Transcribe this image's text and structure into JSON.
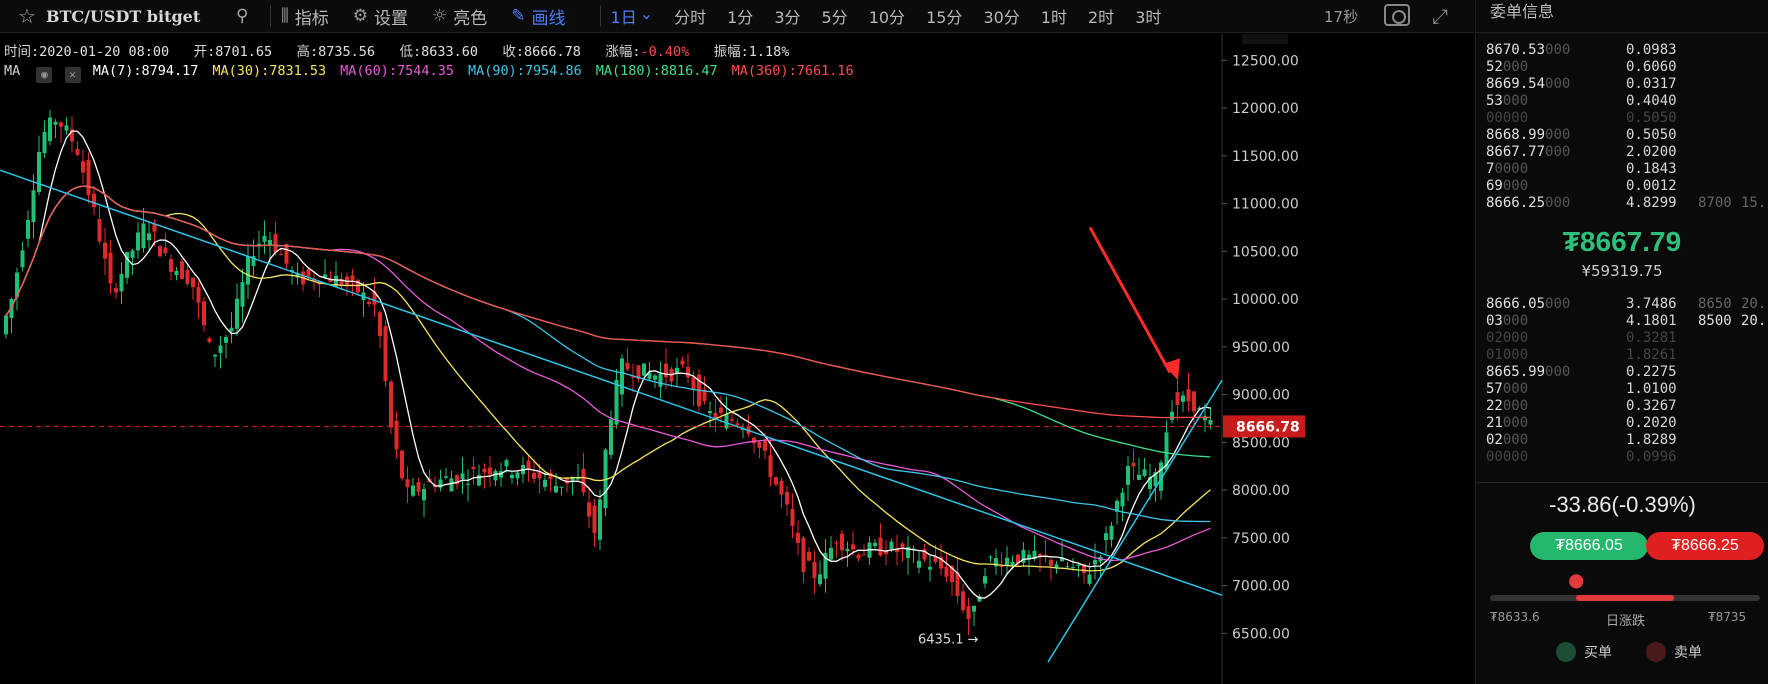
{
  "toolbar": {
    "pair": "BTC/USDT  bitget",
    "indicators_label": "指标",
    "settings_label": "设置",
    "brightness_label": "亮色",
    "draw_label": "画线",
    "timeframes": [
      "1日",
      "分时",
      "1分",
      "3分",
      "5分",
      "10分",
      "15分",
      "30分",
      "1时",
      "2时",
      "3时"
    ],
    "active_timeframe": "1日",
    "timer": "17秒"
  },
  "ohlc": {
    "time_label": "时间:",
    "time": "2020-01-20 08:00",
    "open_label": "开:",
    "open": "8701.65",
    "high_label": "高:",
    "high": "8735.56",
    "low_label": "低:",
    "low": "8633.60",
    "close_label": "收:",
    "close": "8666.78",
    "change_label": "涨幅:",
    "change": "-0.40%",
    "amp_label": "振幅:",
    "amp": "1.18%"
  },
  "ma": {
    "head": "MA",
    "items": [
      {
        "label": "MA(7):8794.17",
        "color": "#ffffff"
      },
      {
        "label": "MA(30):7831.53",
        "color": "#f5e663"
      },
      {
        "label": "MA(60):7544.35",
        "color": "#e85ad8"
      },
      {
        "label": "MA(90):7954.86",
        "color": "#3fc6e8"
      },
      {
        "label": "MA(180):8816.47",
        "color": "#3ee08c"
      },
      {
        "label": "MA(360):7661.16",
        "color": "#ff4d4d"
      }
    ]
  },
  "chart_data": {
    "type": "candlestick",
    "interval": "1日",
    "ylim": [
      6200,
      12650
    ],
    "y_ticks": [
      "12500.00",
      "12000.00",
      "11500.00",
      "11000.00",
      "10500.00",
      "10000.00",
      "9500.00",
      "9000.00",
      "8500.00",
      "8000.00",
      "7500.00",
      "7000.00",
      "6500.00"
    ],
    "current_price": "8666.78",
    "low_annotation": "6435.1 →",
    "trend_desc": "Dense daily candles descending from ~12000 to ~6500 then rebounding to ~8666",
    "colors": {
      "up": "#1fbf75",
      "down": "#e0292b",
      "trendline": "#2ec4e8",
      "arrow": "#ff2a2a"
    }
  },
  "book": {
    "title": "委单信息",
    "asks": [
      {
        "p": "8670.53",
        "d": "000",
        "q": "0.0983",
        "t": "",
        "t2": ""
      },
      {
        "p": "52",
        "d": "000",
        "q": "0.6060",
        "t": "",
        "t2": ""
      },
      {
        "p": "8669.54",
        "d": "000",
        "q": "0.0317",
        "t": "",
        "t2": ""
      },
      {
        "p": "53",
        "d": "000",
        "q": "0.4040",
        "t": "",
        "t2": ""
      },
      {
        "p": "00000",
        "d": "",
        "q": "0.5050",
        "t": "",
        "t2": "",
        "faded": true
      },
      {
        "p": "8668.99",
        "d": "000",
        "q": "0.5050",
        "t": "",
        "t2": ""
      },
      {
        "p": "8667.77",
        "d": "000",
        "q": "2.0200",
        "t": "",
        "t2": ""
      },
      {
        "p": "7",
        "d": "0000",
        "q": "0.1843",
        "t": "",
        "t2": ""
      },
      {
        "p": "69",
        "d": "000",
        "q": "0.0012",
        "t": "",
        "t2": ""
      },
      {
        "p": "8666.25",
        "d": "000",
        "q": "4.8299",
        "t": "8700",
        "t2": "15."
      }
    ],
    "last_price": "₮8667.79",
    "last_cny": "¥59319.75",
    "bids": [
      {
        "p": "8666.05",
        "d": "000",
        "q": "3.7486",
        "t": "8650",
        "t2": "20."
      },
      {
        "p": "03",
        "d": "000",
        "q": "4.1801",
        "t": "8500",
        "t2": "20.",
        "white": true
      },
      {
        "p": "02000",
        "d": "",
        "q": "0.3281",
        "t": "",
        "t2": "",
        "faded": true
      },
      {
        "p": "01000",
        "d": "",
        "q": "1.8261",
        "t": "",
        "t2": "",
        "faded": true
      },
      {
        "p": "8665.99",
        "d": "000",
        "q": "0.2275",
        "t": "",
        "t2": ""
      },
      {
        "p": "57",
        "d": "000",
        "q": "1.0100",
        "t": "",
        "t2": ""
      },
      {
        "p": "22",
        "d": "000",
        "q": "0.3267",
        "t": "",
        "t2": ""
      },
      {
        "p": "21",
        "d": "000",
        "q": "0.2020",
        "t": "",
        "t2": ""
      },
      {
        "p": "02",
        "d": "000",
        "q": "1.8289",
        "t": "",
        "t2": ""
      },
      {
        "p": "00000",
        "d": "",
        "q": "0.0996",
        "t": "",
        "t2": "",
        "faded": true
      }
    ],
    "change": "-33.86(-0.39%)",
    "buy_price": "₮8666.05",
    "sell_price": "₮8666.25",
    "range_low": "₮8633.6",
    "range_label": "日涨跌",
    "range_high": "₮8735",
    "range_position": 0.32,
    "buy_legend": "买单",
    "sell_legend": "卖单"
  }
}
